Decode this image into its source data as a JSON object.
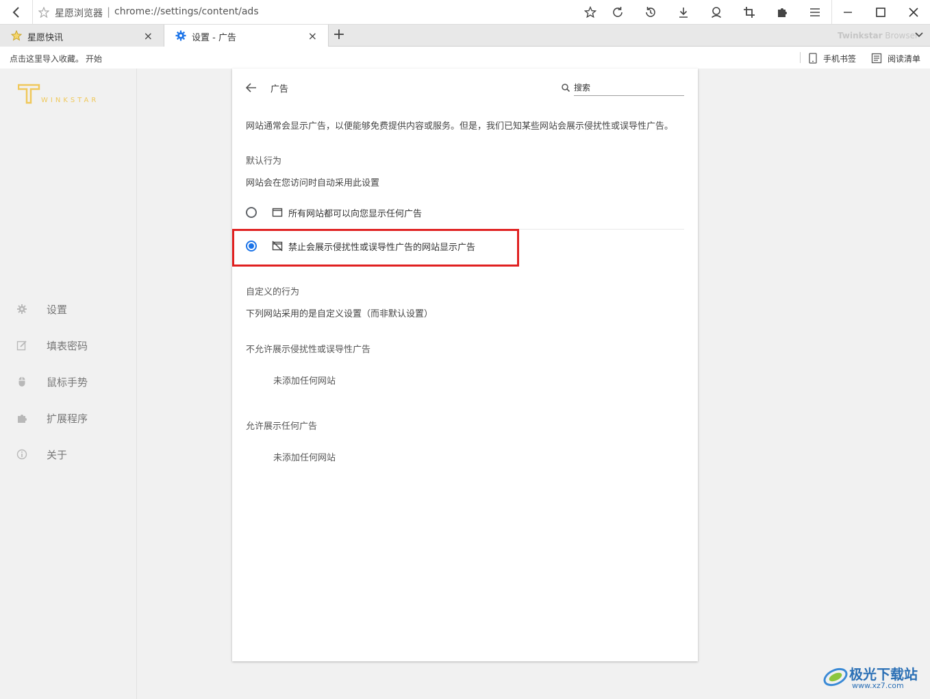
{
  "browser": {
    "site_name": "星愿浏览器",
    "url_separator": "|",
    "url": "chrome://settings/content/ads",
    "brand_bold": "Twinkstar",
    "brand_light": " Browser",
    "toolbar_icons": [
      "star-icon",
      "reload-icon",
      "history-icon",
      "download-icon",
      "account-icon",
      "screenshot-icon",
      "extension-icon",
      "menu-icon"
    ],
    "window_controls": [
      "minimize-icon",
      "maximize-icon",
      "close-icon"
    ]
  },
  "tabs": [
    {
      "label": "星愿快讯",
      "icon": "star-icon",
      "close": "×",
      "active": false
    },
    {
      "label": "设置 - 广告",
      "icon": "gear-icon",
      "close": "×",
      "active": true
    }
  ],
  "newtab": "+",
  "bookmarks": {
    "hint": "点击这里导入收藏。",
    "start": "开始",
    "mobile": "手机书签",
    "reading_list": "阅读清单"
  },
  "sidebar": {
    "logo_text": "WINKSTAR",
    "items": [
      {
        "label": "设置",
        "icon": "gear-icon"
      },
      {
        "label": "填表密码",
        "icon": "edit-icon"
      },
      {
        "label": "鼠标手势",
        "icon": "mouse-icon"
      },
      {
        "label": "扩展程序",
        "icon": "puzzle-icon"
      },
      {
        "label": "关于",
        "icon": "info-icon"
      }
    ]
  },
  "page": {
    "title": "广告",
    "search_placeholder": "搜索",
    "description": "网站通常会显示广告，以便能够免费提供内容或服务。但是，我们已知某些网站会展示侵扰性或误导性广告。",
    "default_heading": "默认行为",
    "default_sub": "网站会在您访问时自动采用此设置",
    "options": [
      {
        "label": "所有网站都可以向您显示任何广告",
        "checked": false
      },
      {
        "label": "禁止会展示侵扰性或误导性广告的网站显示广告",
        "checked": true
      }
    ],
    "custom_heading": "自定义的行为",
    "custom_sub": "下列网站采用的是自定义设置（而非默认设置）",
    "block_heading": "不允许展示侵扰性或误导性广告",
    "block_empty": "未添加任何网站",
    "allow_heading": "允许展示任何广告",
    "allow_empty": "未添加任何网站"
  },
  "watermark": {
    "name": "极光下载站",
    "url": "www.xz7.com"
  },
  "colors": {
    "accent": "#1a73e8",
    "highlight": "#e02020",
    "logo": "#f0c85a"
  }
}
